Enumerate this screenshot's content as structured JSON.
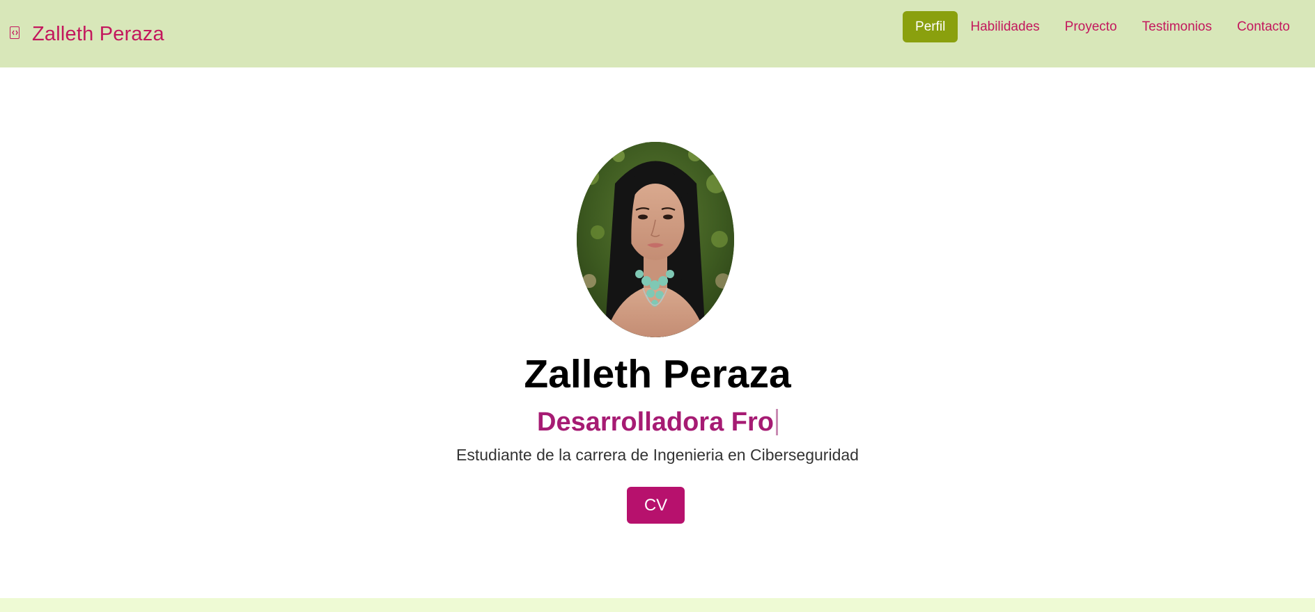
{
  "navbar": {
    "brand_icon": "code-file-icon",
    "brand_name": "Zalleth Peraza",
    "links": [
      {
        "label": "Perfil",
        "active": true
      },
      {
        "label": "Habilidades",
        "active": false
      },
      {
        "label": "Proyecto",
        "active": false
      },
      {
        "label": "Testimonios",
        "active": false
      },
      {
        "label": "Contacto",
        "active": false
      }
    ]
  },
  "hero": {
    "name": "Zalleth Peraza",
    "role_typed": "Desarrolladora Fro",
    "description": "Estudiante de la carrera de Ingenieria en Ciberseguridad",
    "cv_label": "CV"
  },
  "colors": {
    "navbar_bg": "#d8e7b9",
    "accent_pink": "#c3175d",
    "active_green": "#8aa00e",
    "role_magenta": "#a61b73",
    "cv_button": "#b7116d",
    "footer_strip": "#eefad4"
  }
}
